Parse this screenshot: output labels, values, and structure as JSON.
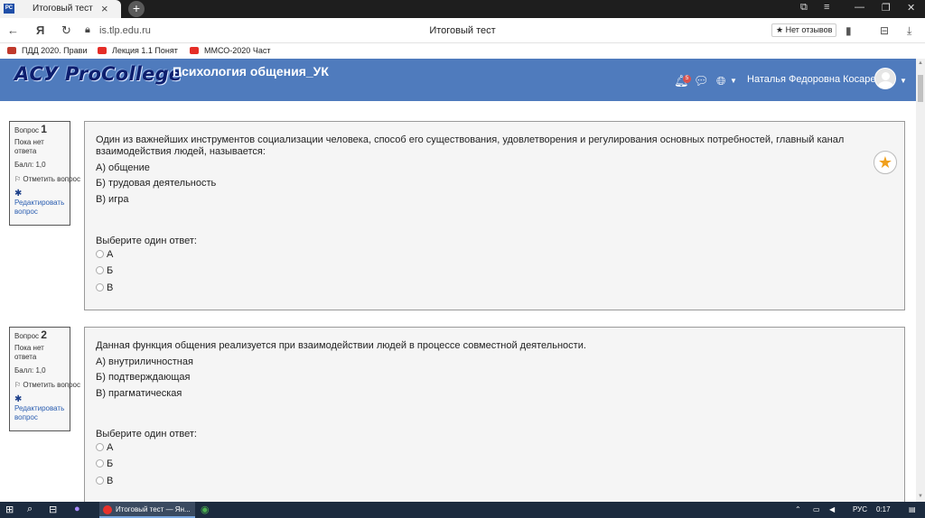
{
  "browser": {
    "tab_title": "Итоговый тест",
    "tab_favicon": "РС",
    "url": "is.tlp.edu.ru",
    "page_title": "Итоговый тест",
    "reviews_label": "★ Нет отзывов",
    "yandex_glyph": "Я"
  },
  "bookmarks": [
    {
      "label": "ПДД 2020. Прави",
      "color": "#c0392b"
    },
    {
      "label": "Лекция 1.1 Понят",
      "color": "#e52d27"
    },
    {
      "label": "ММСО-2020 Част",
      "color": "#e52d27"
    }
  ],
  "site": {
    "logo": "АСУ ProCollege",
    "course_title": "Психология общения_УК",
    "notification_count": "5",
    "user_name": "Наталья Федоровна Косарева",
    "header_color": "#4f7bbd"
  },
  "questions": [
    {
      "label": "Вопрос",
      "number": "1",
      "status": "Пока нет ответа",
      "score": "Балл: 1,0",
      "flag": "Отметить вопрос",
      "edit": "Редактировать вопрос",
      "text": "Один из важнейших инструментов социализации человека, способ его существования, удовлетворения и регулирования основных потребностей, главный канал взаимодействия людей, называется:",
      "options": [
        "А) общение",
        "Б) трудовая деятельность",
        "В) игра"
      ],
      "prompt": "Выберите один ответ:",
      "answers": [
        "А",
        "Б",
        "В"
      ]
    },
    {
      "label": "Вопрос",
      "number": "2",
      "status": "Пока нет ответа",
      "score": "Балл: 1,0",
      "flag": "Отметить вопрос",
      "edit": "Редактировать вопрос",
      "text": "Данная функция общения реализуется при взаимодействии людей в процессе совместной деятельности.",
      "options": [
        "А) внутриличностная",
        "Б) подтверждающая",
        "В) прагматическая"
      ],
      "prompt": "Выберите один ответ:",
      "answers": [
        "А",
        "Б",
        "В"
      ]
    }
  ],
  "taskbar": {
    "app_label": "Итоговый тест — Ян...",
    "lang": "РУС",
    "time": "0:17"
  }
}
